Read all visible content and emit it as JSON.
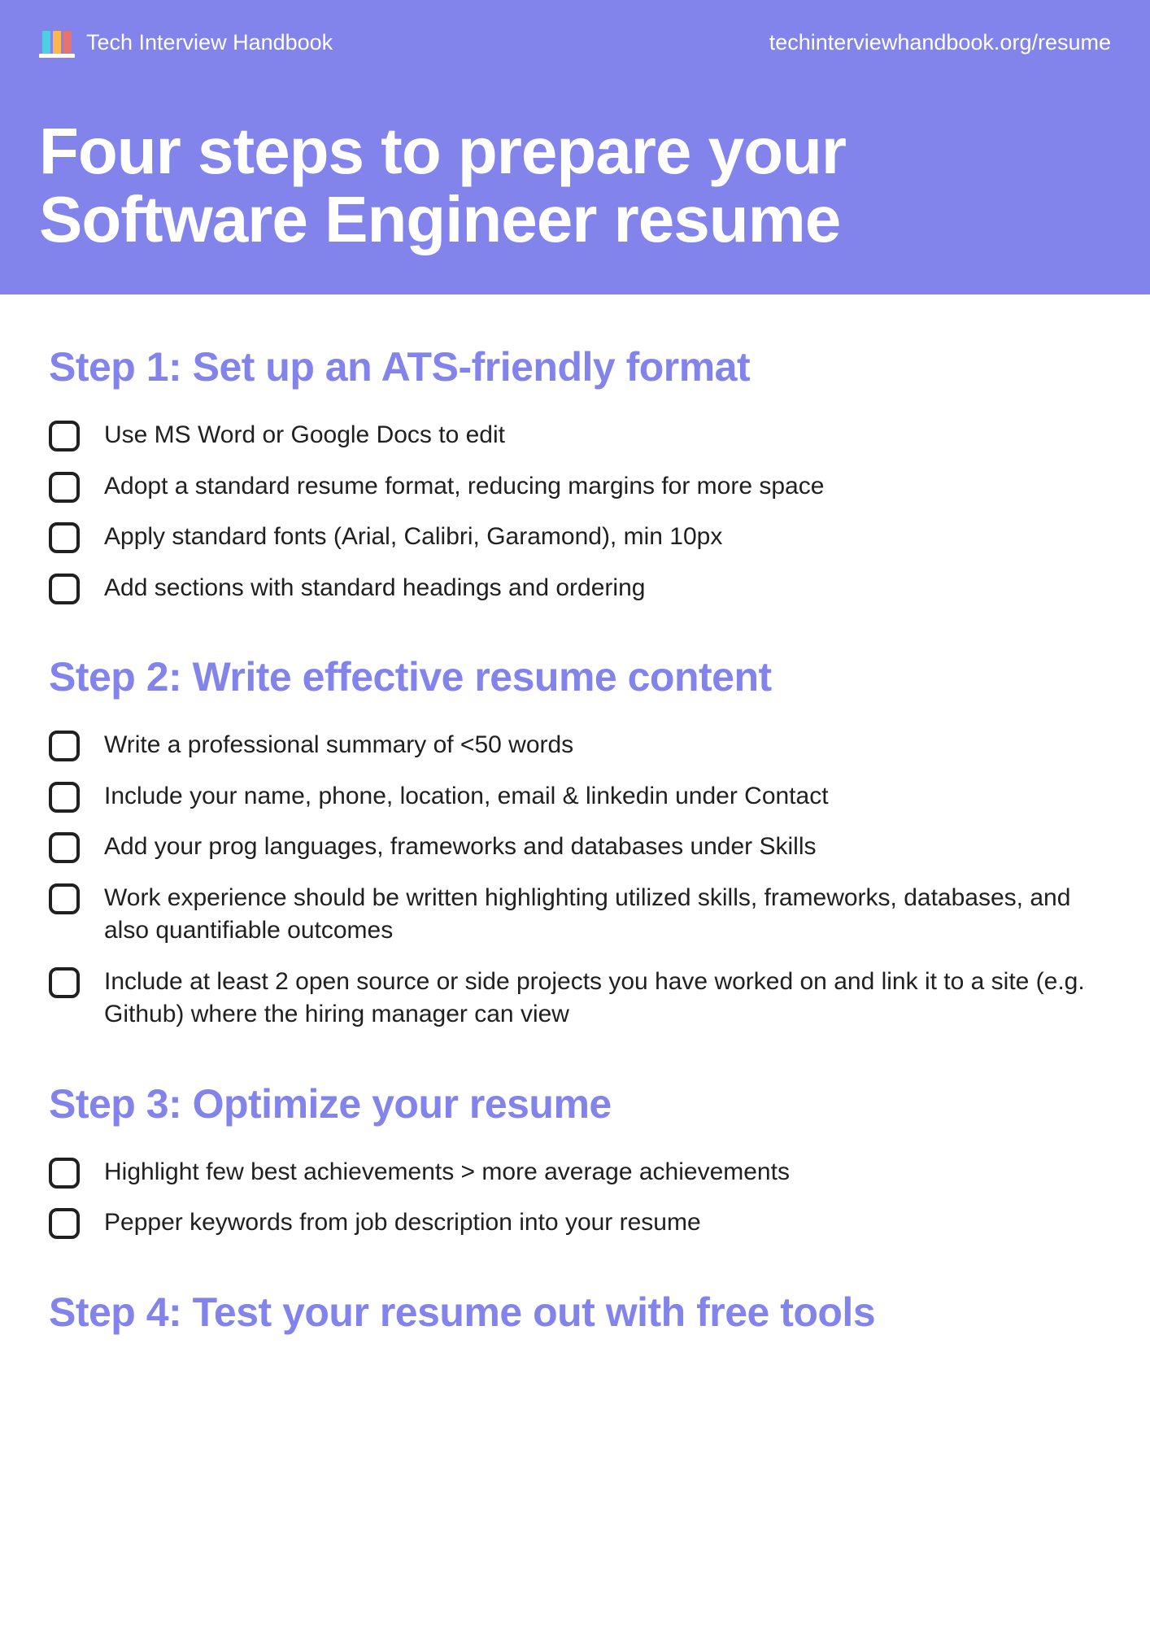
{
  "header": {
    "brand": "Tech Interview Handbook",
    "url": "techinterviewhandbook.org/resume",
    "title": "Four steps to prepare your Software Engineer resume"
  },
  "steps": [
    {
      "title": "Step 1: Set up an ATS-friendly format",
      "items": [
        "Use MS Word or Google Docs to edit",
        "Adopt a standard resume format, reducing margins for more space",
        "Apply standard fonts (Arial, Calibri, Garamond), min 10px",
        "Add sections with standard headings and ordering"
      ]
    },
    {
      "title": "Step 2: Write effective resume content",
      "items": [
        "Write a professional summary of <50 words",
        "Include your name, phone, location, email & linkedin under Contact",
        "Add your prog languages, frameworks and databases under Skills",
        "Work experience should be written highlighting utilized skills, frameworks, databases, and also quantifiable outcomes",
        "Include at least 2 open source or side projects you have worked on and link it to a site (e.g. Github) where the hiring manager can view"
      ]
    },
    {
      "title": "Step 3: Optimize your resume",
      "items": [
        "Highlight few best achievements > more average achievements",
        "Pepper keywords from job description into your resume"
      ]
    },
    {
      "title": "Step 4: Test your resume out with free tools",
      "items": []
    }
  ]
}
